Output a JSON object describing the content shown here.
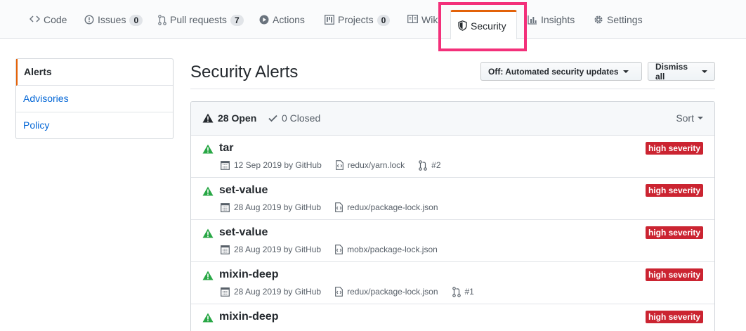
{
  "tabs": [
    {
      "label": "Code",
      "icon": "code-icon"
    },
    {
      "label": "Issues",
      "icon": "issue-icon",
      "count": "0"
    },
    {
      "label": "Pull requests",
      "icon": "pull-request-icon",
      "count": "7"
    },
    {
      "label": "Actions",
      "icon": "play-icon"
    },
    {
      "label": "Projects",
      "icon": "project-icon",
      "count": "0"
    },
    {
      "label": "Wiki",
      "icon": "book-icon"
    },
    {
      "label": "Security",
      "icon": "shield-icon",
      "selected": true
    },
    {
      "label": "Insights",
      "icon": "graph-icon"
    },
    {
      "label": "Settings",
      "icon": "gear-icon"
    }
  ],
  "menu": {
    "items": [
      {
        "label": "Alerts",
        "selected": true
      },
      {
        "label": "Advisories"
      },
      {
        "label": "Policy"
      }
    ]
  },
  "header": {
    "title": "Security Alerts",
    "auto_updates_label": "Off: Automated security updates",
    "dismiss_label": "Dismiss all"
  },
  "box": {
    "open_label": "28 Open",
    "closed_label": "0 Closed",
    "sort_label": "Sort"
  },
  "alerts": [
    {
      "name": "tar",
      "severity": "high severity",
      "date": "12 Sep 2019 by GitHub",
      "file": "redux/yarn.lock",
      "pr": "#2"
    },
    {
      "name": "set-value",
      "severity": "high severity",
      "date": "28 Aug 2019 by GitHub",
      "file": "redux/package-lock.json"
    },
    {
      "name": "set-value",
      "severity": "high severity",
      "date": "28 Aug 2019 by GitHub",
      "file": "mobx/package-lock.json"
    },
    {
      "name": "mixin-deep",
      "severity": "high severity",
      "date": "28 Aug 2019 by GitHub",
      "file": "redux/package-lock.json",
      "pr": "#1"
    },
    {
      "name": "mixin-deep",
      "severity": "high severity",
      "date": "",
      "file": ""
    }
  ],
  "colors": {
    "accent": "#e36209",
    "highlight": "#f3307a",
    "severity": "#cb2431",
    "link": "#0366d6",
    "alert_icon": "#28a745"
  }
}
